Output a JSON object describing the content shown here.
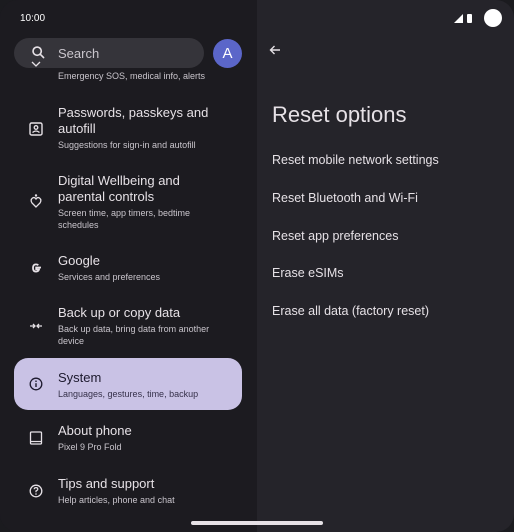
{
  "status": {
    "time": "10:00"
  },
  "search": {
    "placeholder": "Search"
  },
  "account": {
    "initial": "A"
  },
  "settings": {
    "items": [
      {
        "title": "",
        "subtitle": "Emergency SOS, medical info, alerts"
      },
      {
        "title": "Passwords, passkeys and",
        "title2": "autofill",
        "subtitle": "Suggestions for sign-in and autofill"
      },
      {
        "title": "Digital Wellbeing and",
        "title2": "parental controls",
        "subtitle": "Screen time, app timers, bedtime",
        "subtitle2": "schedules"
      },
      {
        "title": "Google",
        "subtitle": "Services and preferences"
      },
      {
        "title": "Back up or copy data",
        "subtitle": "Back up data, bring data from another",
        "subtitle2": "device"
      },
      {
        "title": "System",
        "subtitle": "Languages, gestures, time, backup"
      },
      {
        "title": "About phone",
        "subtitle": "Pixel 9 Pro Fold"
      },
      {
        "title": "Tips and support",
        "subtitle": "Help articles, phone and chat"
      }
    ]
  },
  "reset": {
    "title": "Reset options",
    "options": [
      "Reset mobile network settings",
      "Reset Bluetooth and Wi-Fi",
      "Reset app preferences",
      "Erase eSIMs",
      "Erase all data (factory reset)"
    ]
  },
  "colors": {
    "accent": "#5b66c9",
    "selected": "#c9c2e5",
    "background": "#1c1b20"
  }
}
